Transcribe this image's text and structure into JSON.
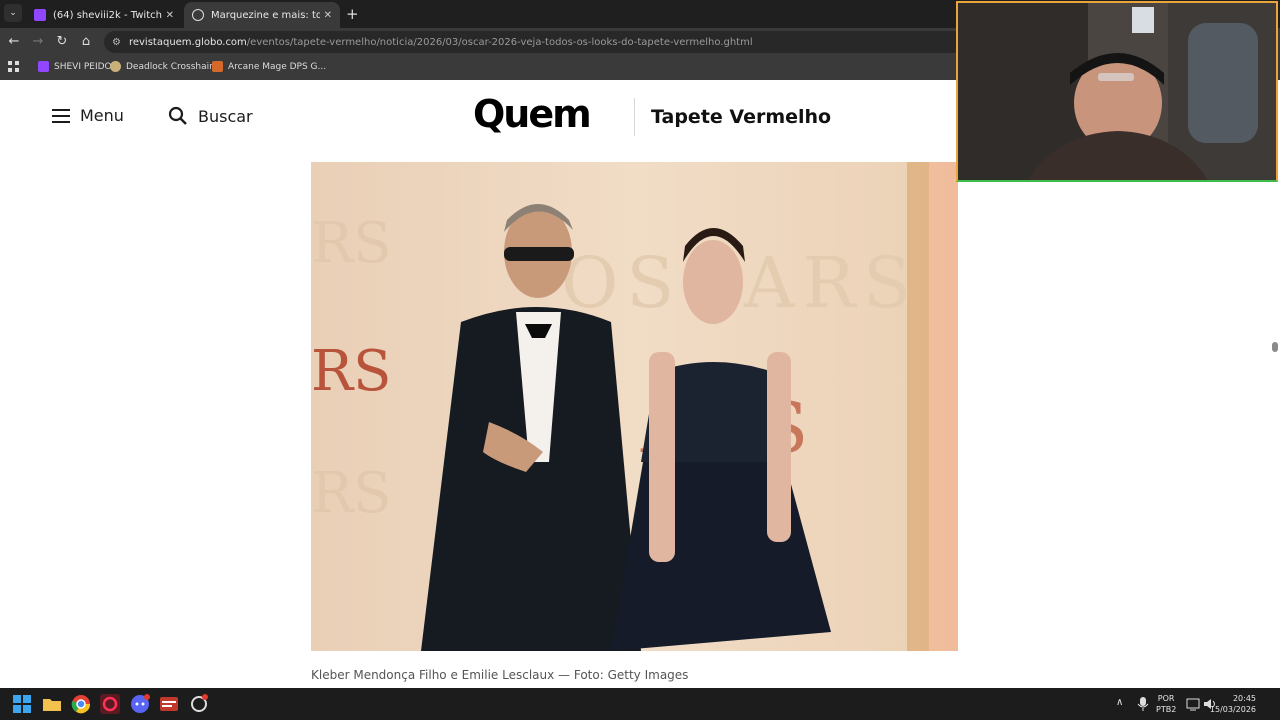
{
  "browser": {
    "tabs": [
      {
        "title": "(64) sheviii2k - Twitch",
        "active": false
      },
      {
        "title": "Marquezine e mais: todos os lo",
        "active": true
      }
    ],
    "url_host": "revistaquem.globo.com",
    "url_path": "/eventos/tapete-vermelho/noticia/2026/03/oscar-2026-veja-todos-os-looks-do-tapete-vermelho.ghtml",
    "bookmarks": [
      "SHEVI PEIDO",
      "Deadlock Crosshair...",
      "Arcane Mage DPS G..."
    ]
  },
  "header": {
    "menu_label": "Menu",
    "search_label": "Buscar",
    "logo": "Quem",
    "section": "Tapete Vermelho"
  },
  "article": {
    "photo_backdrop_text": "OSCARS",
    "caption": "Kleber Mendonça Filho e Emilie Lesclaux — Foto: Getty Images"
  },
  "taskbar": {
    "lang_top": "POR",
    "lang_bottom": "PTB2",
    "time": "20:45",
    "date": "15/03/2026"
  },
  "colors": {
    "twitch": "#9146ff",
    "webcam_border_top": "#e9a53a",
    "webcam_border_bottom": "#3dbb4b"
  }
}
